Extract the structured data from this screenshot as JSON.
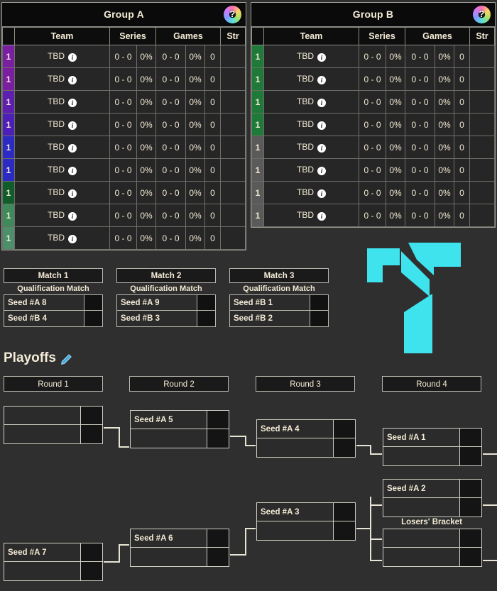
{
  "theme": {
    "background": "#2f2f2f",
    "table_bg": "#262626",
    "header_bg": "#0a0a0a",
    "text": "#f3ead5",
    "border": "#b9b9b0",
    "accent_cyan": "#3fe3ee",
    "rank_colors_group_a": [
      "#7b1fa2",
      "#7b1fa2",
      "#5e1fb0",
      "#4e1fb8",
      "#2b2bc4",
      "#2b2bc4",
      "#115c2b",
      "#3e8a5c",
      "#4d8f6a"
    ],
    "rank_colors_group_b": [
      "#1f7a3a",
      "#1f7a3a",
      "#1f7a3a",
      "#1f7a3a",
      "#5a5a5a",
      "#5a5a5a",
      "#5a5a5a",
      "#5a5a5a"
    ]
  },
  "groups": [
    {
      "id": "group-a",
      "title": "Group A",
      "help_icon": "help-icon",
      "columns": [
        "",
        "Team",
        "Series",
        "",
        "Games",
        "",
        "",
        "Str"
      ],
      "headers": {
        "team": "Team",
        "series": "Series",
        "games": "Games",
        "streak": "Str"
      },
      "rows": [
        {
          "rank": "1",
          "team": "TBD",
          "series": "0 - 0",
          "series_pct": "0%",
          "games": "0 - 0",
          "games_pct": "0%",
          "diff": "0",
          "streak": ""
        },
        {
          "rank": "1",
          "team": "TBD",
          "series": "0 - 0",
          "series_pct": "0%",
          "games": "0 - 0",
          "games_pct": "0%",
          "diff": "0",
          "streak": ""
        },
        {
          "rank": "1",
          "team": "TBD",
          "series": "0 - 0",
          "series_pct": "0%",
          "games": "0 - 0",
          "games_pct": "0%",
          "diff": "0",
          "streak": ""
        },
        {
          "rank": "1",
          "team": "TBD",
          "series": "0 - 0",
          "series_pct": "0%",
          "games": "0 - 0",
          "games_pct": "0%",
          "diff": "0",
          "streak": ""
        },
        {
          "rank": "1",
          "team": "TBD",
          "series": "0 - 0",
          "series_pct": "0%",
          "games": "0 - 0",
          "games_pct": "0%",
          "diff": "0",
          "streak": ""
        },
        {
          "rank": "1",
          "team": "TBD",
          "series": "0 - 0",
          "series_pct": "0%",
          "games": "0 - 0",
          "games_pct": "0%",
          "diff": "0",
          "streak": ""
        },
        {
          "rank": "1",
          "team": "TBD",
          "series": "0 - 0",
          "series_pct": "0%",
          "games": "0 - 0",
          "games_pct": "0%",
          "diff": "0",
          "streak": ""
        },
        {
          "rank": "1",
          "team": "TBD",
          "series": "0 - 0",
          "series_pct": "0%",
          "games": "0 - 0",
          "games_pct": "0%",
          "diff": "0",
          "streak": ""
        },
        {
          "rank": "1",
          "team": "TBD",
          "series": "0 - 0",
          "series_pct": "0%",
          "games": "0 - 0",
          "games_pct": "0%",
          "diff": "0",
          "streak": ""
        }
      ]
    },
    {
      "id": "group-b",
      "title": "Group B",
      "help_icon": "help-icon",
      "columns": [
        "",
        "Team",
        "Series",
        "",
        "Games",
        "",
        "",
        "Str"
      ],
      "headers": {
        "team": "Team",
        "series": "Series",
        "games": "Games",
        "streak": "Str"
      },
      "rows": [
        {
          "rank": "1",
          "team": "TBD",
          "series": "0 - 0",
          "series_pct": "0%",
          "games": "0 - 0",
          "games_pct": "0%",
          "diff": "0",
          "streak": ""
        },
        {
          "rank": "1",
          "team": "TBD",
          "series": "0 - 0",
          "series_pct": "0%",
          "games": "0 - 0",
          "games_pct": "0%",
          "diff": "0",
          "streak": ""
        },
        {
          "rank": "1",
          "team": "TBD",
          "series": "0 - 0",
          "series_pct": "0%",
          "games": "0 - 0",
          "games_pct": "0%",
          "diff": "0",
          "streak": ""
        },
        {
          "rank": "1",
          "team": "TBD",
          "series": "0 - 0",
          "series_pct": "0%",
          "games": "0 - 0",
          "games_pct": "0%",
          "diff": "0",
          "streak": ""
        },
        {
          "rank": "1",
          "team": "TBD",
          "series": "0 - 0",
          "series_pct": "0%",
          "games": "0 - 0",
          "games_pct": "0%",
          "diff": "0",
          "streak": ""
        },
        {
          "rank": "1",
          "team": "TBD",
          "series": "0 - 0",
          "series_pct": "0%",
          "games": "0 - 0",
          "games_pct": "0%",
          "diff": "0",
          "streak": ""
        },
        {
          "rank": "1",
          "team": "TBD",
          "series": "0 - 0",
          "series_pct": "0%",
          "games": "0 - 0",
          "games_pct": "0%",
          "diff": "0",
          "streak": ""
        },
        {
          "rank": "1",
          "team": "TBD",
          "series": "0 - 0",
          "series_pct": "0%",
          "games": "0 - 0",
          "games_pct": "0%",
          "diff": "0",
          "streak": ""
        }
      ]
    }
  ],
  "qualification_matches": [
    {
      "title": "Match 1",
      "subtitle": "Qualification Match",
      "teams": [
        {
          "name": "Seed #A 8",
          "score": ""
        },
        {
          "name": "Seed #B 4",
          "score": ""
        }
      ]
    },
    {
      "title": "Match 2",
      "subtitle": "Qualification Match",
      "teams": [
        {
          "name": "Seed #A 9",
          "score": ""
        },
        {
          "name": "Seed #B 3",
          "score": ""
        }
      ]
    },
    {
      "title": "Match 3",
      "subtitle": "Qualification Match",
      "teams": [
        {
          "name": "Seed #B 1",
          "score": ""
        },
        {
          "name": "Seed #B 2",
          "score": ""
        }
      ]
    }
  ],
  "playoffs": {
    "title": "Playoffs",
    "edit_icon": "pencil-edit-icon",
    "rounds": [
      "Round 1",
      "Round 2",
      "Round 3",
      "Round 4"
    ],
    "losers_bracket_label": "Losers' Bracket",
    "matches": [
      {
        "id": "r1-m1",
        "round": 1,
        "top": {
          "name": "",
          "score": ""
        },
        "bottom": {
          "name": "",
          "score": ""
        }
      },
      {
        "id": "r1-m2",
        "round": 1,
        "top": {
          "name": "Seed #A 7",
          "score": ""
        },
        "bottom": {
          "name": "",
          "score": ""
        }
      },
      {
        "id": "r2-m1",
        "round": 2,
        "top": {
          "name": "Seed #A 5",
          "score": ""
        },
        "bottom": {
          "name": "",
          "score": ""
        }
      },
      {
        "id": "r2-m2",
        "round": 2,
        "top": {
          "name": "Seed #A 6",
          "score": ""
        },
        "bottom": {
          "name": "",
          "score": ""
        }
      },
      {
        "id": "r3-m1",
        "round": 3,
        "top": {
          "name": "Seed #A 4",
          "score": ""
        },
        "bottom": {
          "name": "",
          "score": ""
        }
      },
      {
        "id": "r3-m2",
        "round": 3,
        "top": {
          "name": "Seed #A 3",
          "score": ""
        },
        "bottom": {
          "name": "",
          "score": ""
        }
      },
      {
        "id": "r4-m1",
        "round": 4,
        "top": {
          "name": "Seed #A 1",
          "score": ""
        },
        "bottom": {
          "name": "",
          "score": ""
        }
      },
      {
        "id": "r4-m2",
        "round": 4,
        "top": {
          "name": "Seed #A 2",
          "score": ""
        },
        "bottom": {
          "name": "",
          "score": ""
        }
      },
      {
        "id": "r4-lb",
        "round": 4,
        "top": {
          "name": "",
          "score": ""
        },
        "bottom": {
          "name": "",
          "score": ""
        }
      }
    ]
  }
}
